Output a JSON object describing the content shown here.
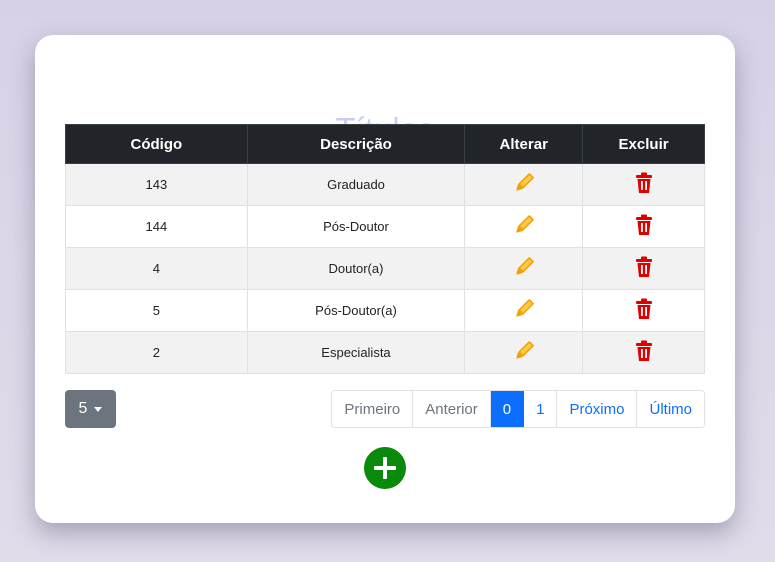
{
  "page": {
    "title": "Títulos"
  },
  "table": {
    "headers": {
      "code": "Código",
      "description": "Descrição",
      "edit": "Alterar",
      "delete": "Excluir"
    },
    "rows": [
      {
        "code": "143",
        "description": "Graduado"
      },
      {
        "code": "144",
        "description": "Pós-Doutor"
      },
      {
        "code": "4",
        "description": "Doutor(a)"
      },
      {
        "code": "5",
        "description": "Pós-Doutor(a)"
      },
      {
        "code": "2",
        "description": "Especialista"
      }
    ]
  },
  "page_size": {
    "value": "5"
  },
  "pagination": {
    "first": "Primeiro",
    "previous": "Anterior",
    "page_0": "0",
    "page_1": "1",
    "next": "Próximo",
    "last": "Último"
  },
  "icons": {
    "edit": "pencil-icon",
    "delete": "trash-icon",
    "add": "plus-icon"
  },
  "colors": {
    "edit_icon": "#f0a000",
    "delete_icon": "#e00000",
    "add_button": "#0a8a0a",
    "active_page": "#0d6efd",
    "title": "#c9cdf6"
  }
}
